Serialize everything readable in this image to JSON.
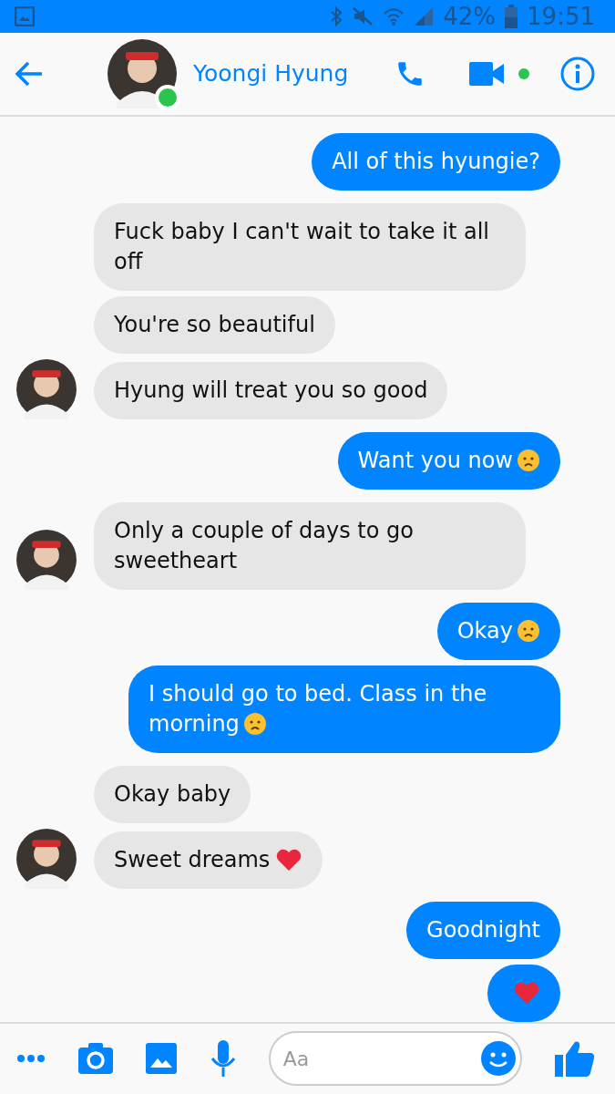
{
  "status_bar": {
    "battery": "42%",
    "time": "19:51"
  },
  "header": {
    "name": "Yoongi Hyung",
    "online": true,
    "video_active": true
  },
  "messages": [
    {
      "kind": "sent",
      "text": "All of this hyungie?",
      "avatar": false,
      "worried_emoji": false,
      "heart_emoji": false
    },
    {
      "kind": "received",
      "text": "Fuck baby I can't wait to take it all off",
      "avatar": false,
      "worried_emoji": false,
      "heart_emoji": false
    },
    {
      "kind": "received",
      "text": "You're so beautiful",
      "avatar": false,
      "worried_emoji": false,
      "heart_emoji": false
    },
    {
      "kind": "received",
      "text": "Hyung will treat you so good",
      "avatar": true,
      "worried_emoji": false,
      "heart_emoji": false
    },
    {
      "kind": "sent",
      "text": "Want you now",
      "avatar": false,
      "worried_emoji": true,
      "heart_emoji": false
    },
    {
      "kind": "received",
      "text": "Only a couple of days to go sweetheart",
      "avatar": true,
      "worried_emoji": false,
      "heart_emoji": false
    },
    {
      "kind": "sent",
      "text": "Okay",
      "avatar": false,
      "worried_emoji": true,
      "heart_emoji": false
    },
    {
      "kind": "sent",
      "text": "I should go to bed. Class in the morning",
      "avatar": false,
      "worried_emoji": true,
      "heart_emoji": false
    },
    {
      "kind": "received",
      "text": "Okay baby",
      "avatar": false,
      "worried_emoji": false,
      "heart_emoji": false
    },
    {
      "kind": "received",
      "text": "Sweet dreams",
      "avatar": true,
      "worried_emoji": false,
      "heart_emoji": true
    },
    {
      "kind": "sent",
      "text": "Goodnight",
      "avatar": false,
      "worried_emoji": false,
      "heart_emoji": false
    },
    {
      "kind": "sent",
      "avatar": false,
      "worried_emoji": false,
      "heart_emoji": true
    }
  ],
  "composer": {
    "placeholder": "Aa"
  }
}
